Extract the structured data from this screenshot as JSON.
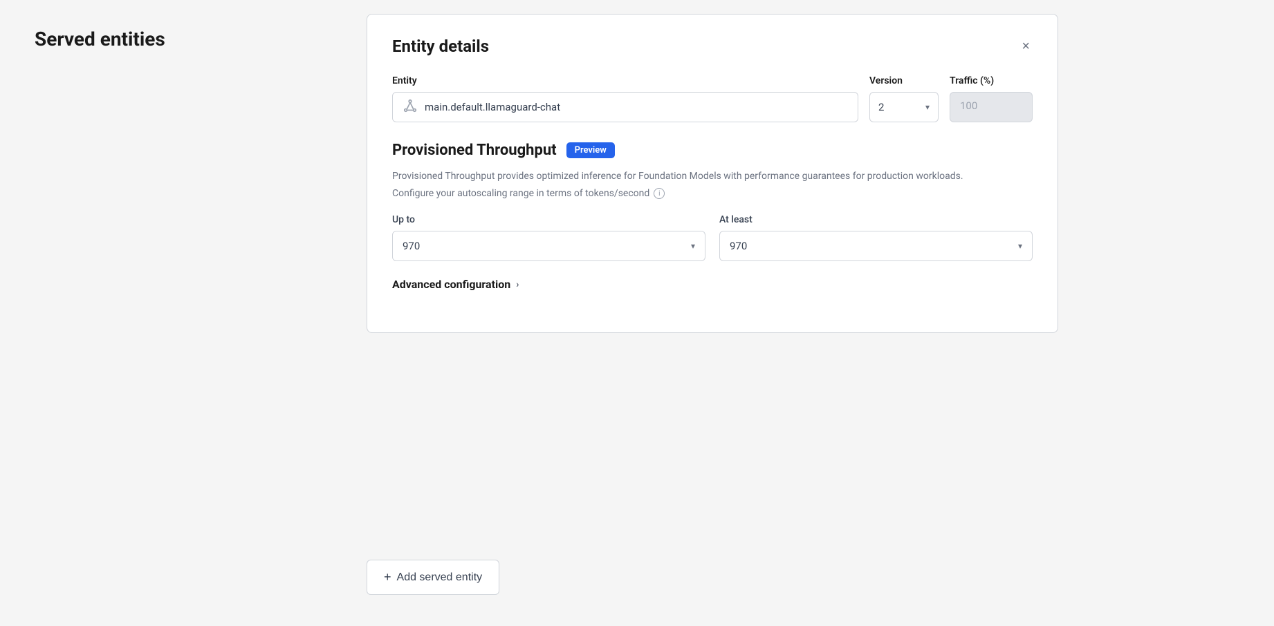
{
  "page": {
    "title": "Served entities",
    "background": "#f5f5f5"
  },
  "modal": {
    "title": "Entity details",
    "close_label": "×",
    "entity_label": "Entity",
    "entity_value": "main.default.llamaguard-chat",
    "entity_placeholder": "main.default.llamaguard-chat",
    "version_label": "Version",
    "version_value": "2",
    "traffic_label": "Traffic (%)",
    "traffic_value": "100",
    "provisioned": {
      "title": "Provisioned Throughput",
      "badge": "Preview",
      "description": "Provisioned Throughput provides optimized inference for Foundation Models with performance guarantees for production workloads.",
      "configure_text": "Configure your autoscaling range in terms of tokens/second",
      "up_to_label": "Up to",
      "up_to_value": "970",
      "at_least_label": "At least",
      "at_least_value": "970",
      "advanced_config_label": "Advanced configuration"
    }
  },
  "add_button": {
    "label": "Add served entity",
    "plus": "+"
  },
  "icons": {
    "model_icon": "⬡",
    "chevron_down": "▾",
    "chevron_right": "›",
    "info": "i",
    "close": "×"
  }
}
